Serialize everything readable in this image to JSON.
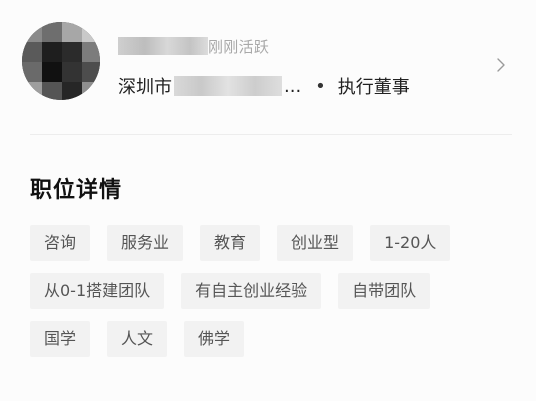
{
  "recruiter": {
    "avatar_icon": "avatar-pixelated",
    "active_status": "刚刚活跃",
    "company_prefix": "深圳市",
    "company_ellipsis": "...",
    "separator": "•",
    "title": "执行董事",
    "chevron_icon": "chevron-right-icon"
  },
  "job_detail": {
    "heading": "职位详情",
    "tag_rows": [
      [
        "咨询",
        "服务业",
        "教育",
        "创业型",
        "1-20人"
      ],
      [
        "从0-1搭建团队",
        "有自主创业经验",
        "自带团队"
      ],
      [
        "国学",
        "人文",
        "佛学"
      ]
    ]
  },
  "colors": {
    "tag_background": "#f2f2f2",
    "tag_text": "#555555",
    "muted_text": "#a8a8a8",
    "divider": "#ededed"
  }
}
